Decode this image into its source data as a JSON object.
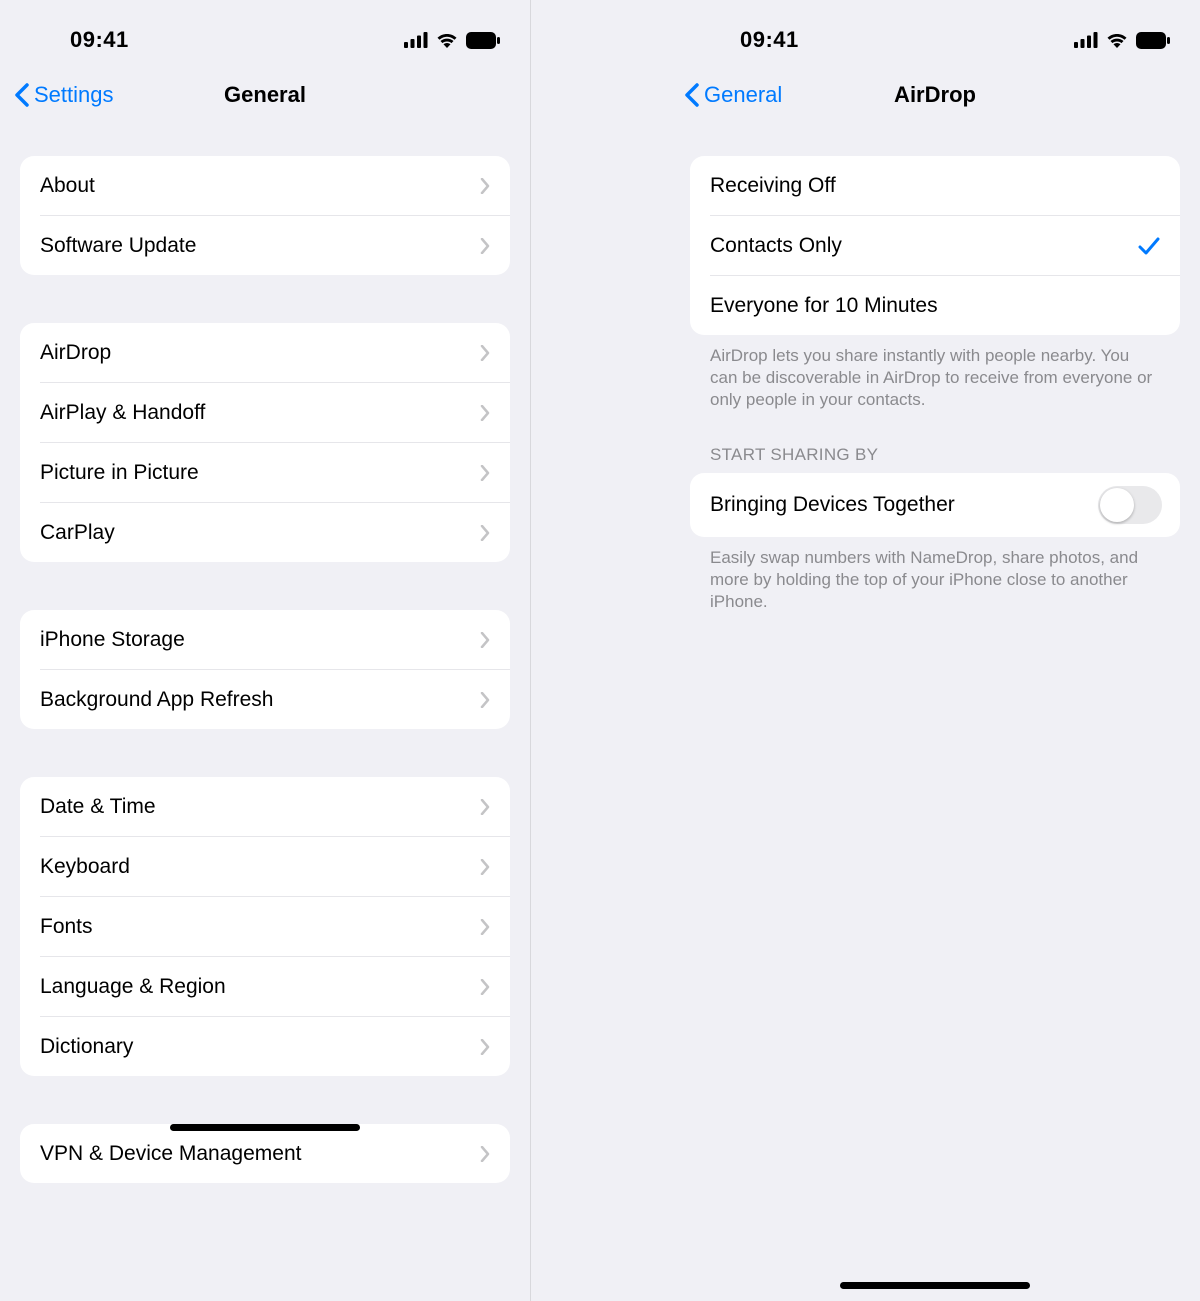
{
  "status": {
    "time": "09:41"
  },
  "left": {
    "back_label": "Settings",
    "title": "General",
    "groups": [
      [
        "About",
        "Software Update"
      ],
      [
        "AirDrop",
        "AirPlay & Handoff",
        "Picture in Picture",
        "CarPlay"
      ],
      [
        "iPhone Storage",
        "Background App Refresh"
      ],
      [
        "Date & Time",
        "Keyboard",
        "Fonts",
        "Language & Region",
        "Dictionary"
      ],
      [
        "VPN & Device Management"
      ]
    ]
  },
  "right": {
    "back_label": "General",
    "title": "AirDrop",
    "options": [
      {
        "label": "Receiving Off",
        "selected": false
      },
      {
        "label": "Contacts Only",
        "selected": true
      },
      {
        "label": "Everyone for 10 Minutes",
        "selected": false
      }
    ],
    "options_footer": "AirDrop lets you share instantly with people nearby. You can be discoverable in AirDrop to receive from everyone or only people in your contacts.",
    "sharing_header": "START SHARING BY",
    "toggle_label": "Bringing Devices Together",
    "toggle_on": false,
    "sharing_footer": "Easily swap numbers with NameDrop, share photos, and more by holding the top of your iPhone close to another iPhone."
  }
}
